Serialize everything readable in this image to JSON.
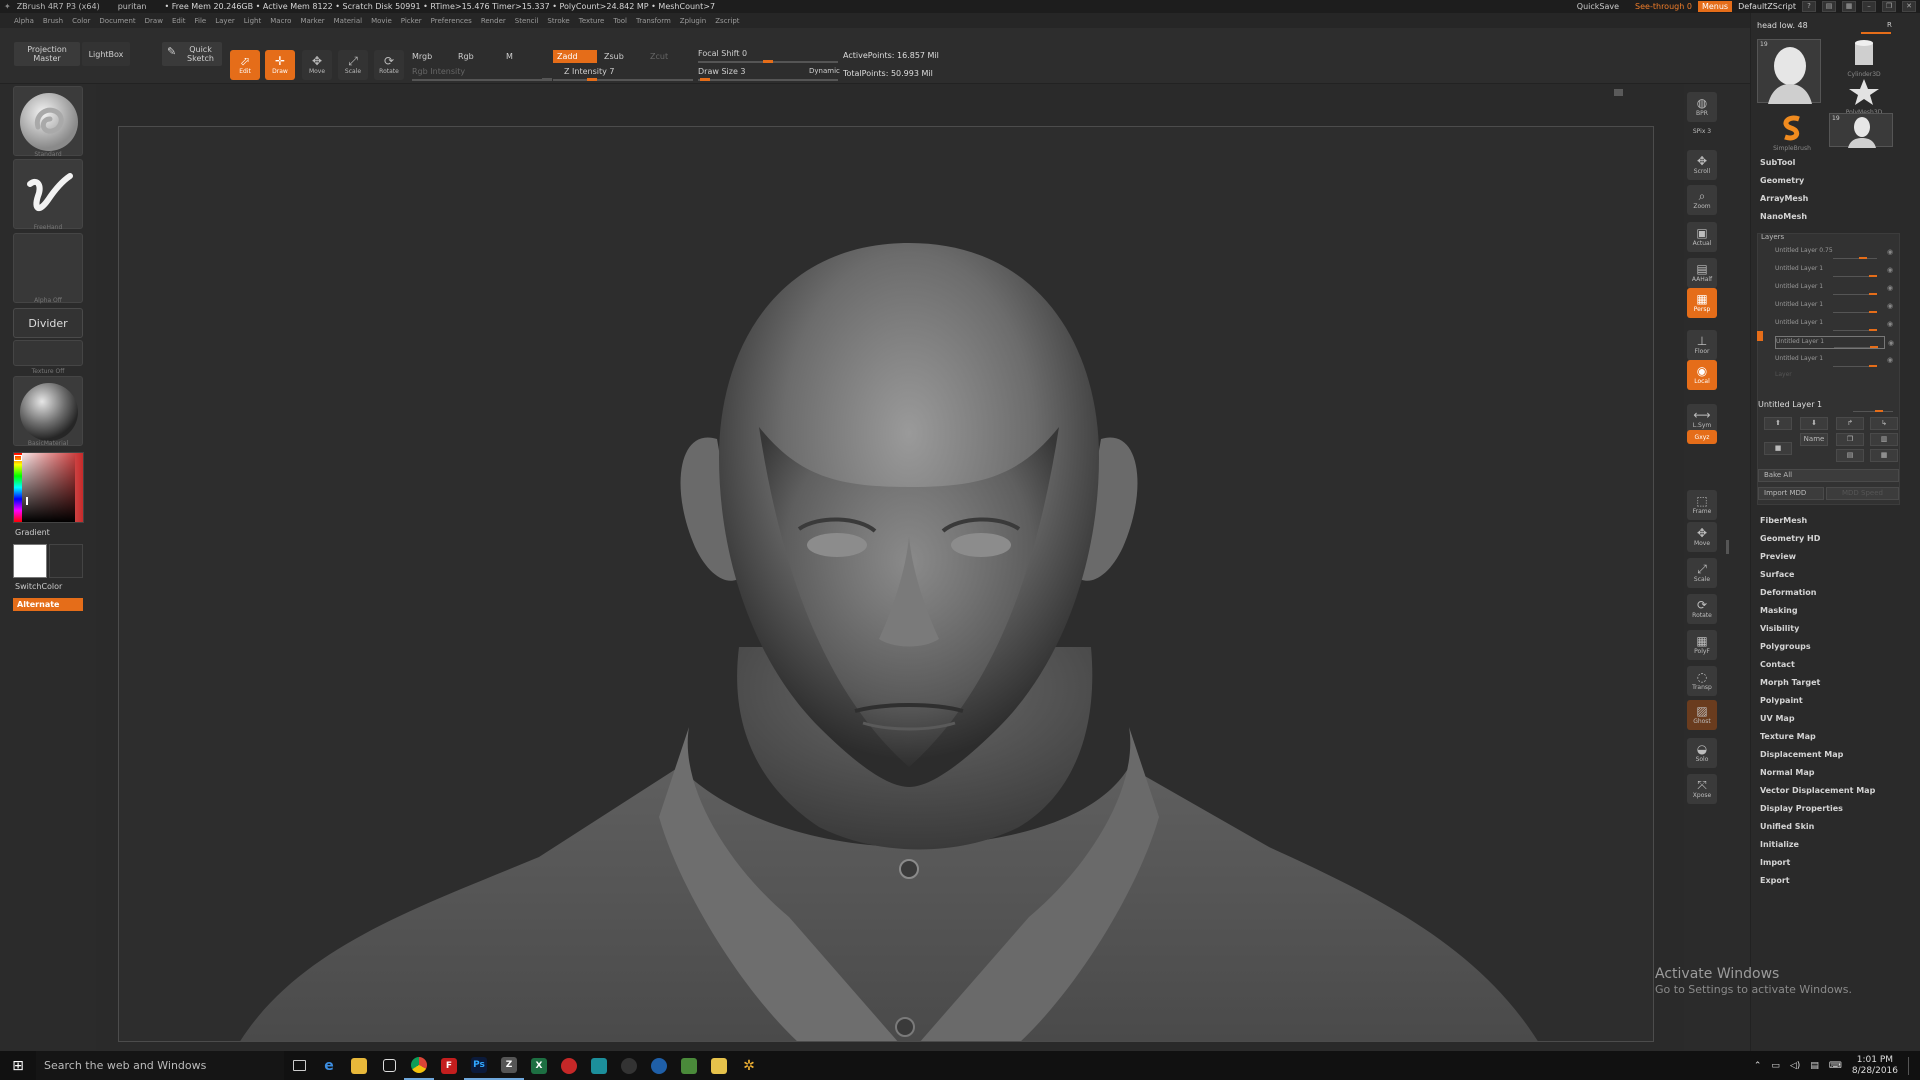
{
  "titlebar": {
    "app_title": "ZBrush 4R7 P3 (x64)",
    "project": "puritan",
    "stats": "• Free Mem 20.246GB • Active Mem 8122 • Scratch Disk 50991 • RTime>15.476 Timer>15.337 • PolyCount>24.842 MP • MeshCount>7",
    "quicksave": "QuickSave",
    "see_through": "See-through",
    "see_through_value": "0",
    "menus": "Menus",
    "script": "DefaultZScript"
  },
  "menubar": [
    "Alpha",
    "Brush",
    "Color",
    "Document",
    "Draw",
    "Edit",
    "File",
    "Layer",
    "Light",
    "Macro",
    "Marker",
    "Material",
    "Movie",
    "Picker",
    "Preferences",
    "Render",
    "Stencil",
    "Stroke",
    "Texture",
    "Tool",
    "Transform",
    "Zplugin",
    "Zscript"
  ],
  "toolbar": {
    "projection_master": "Projection\nMaster",
    "lightbox": "LightBox",
    "quick_sketch": "Quick\nSketch",
    "edit": "Edit",
    "draw": "Draw",
    "move": "Move",
    "scale": "Scale",
    "rotate": "Rotate",
    "mrgb": "Mrgb",
    "rgb": "Rgb",
    "m": "M",
    "rgb_intensity": "Rgb Intensity",
    "zadd": "Zadd",
    "zsub": "Zsub",
    "zcut": "Zcut",
    "z_intensity": "Z Intensity 7",
    "focal_shift": "Focal Shift 0",
    "draw_size": "Draw Size 3",
    "dynamic": "Dynamic",
    "active_points": "ActivePoints: 16.857 Mil",
    "total_points": "TotalPoints: 50.993 Mil"
  },
  "left_shelf": {
    "standard": "Standard",
    "freehand": "FreeHand",
    "alpha_off": "Alpha Off",
    "divider": "Divider",
    "texture_off": "Texture Off",
    "material": "BasicMaterial",
    "gradient": "Gradient",
    "switchcolor": "SwitchColor",
    "alternate": "Alternate"
  },
  "right_shelf": [
    {
      "name": "bpr",
      "label": "BPR"
    },
    {
      "name": "spix",
      "label": "SPix 3"
    },
    {
      "name": "scroll",
      "label": "Scroll"
    },
    {
      "name": "zoom",
      "label": "Zoom"
    },
    {
      "name": "actual",
      "label": "Actual"
    },
    {
      "name": "aahalf",
      "label": "AAHalf"
    },
    {
      "name": "persp",
      "label": "Persp"
    },
    {
      "name": "floor",
      "label": "Floor"
    },
    {
      "name": "local",
      "label": "Local"
    },
    {
      "name": "lsym",
      "label": "L.Sym"
    },
    {
      "name": "xyz",
      "label": "Gxyz"
    },
    {
      "name": "frame",
      "label": "Frame"
    },
    {
      "name": "move",
      "label": "Move"
    },
    {
      "name": "scale",
      "label": "Scale"
    },
    {
      "name": "rotate",
      "label": "Rotate"
    },
    {
      "name": "polyf",
      "label": "PolyF"
    },
    {
      "name": "transp",
      "label": "Transp"
    },
    {
      "name": "ghost",
      "label": "Ghost"
    },
    {
      "name": "solo",
      "label": "Solo"
    },
    {
      "name": "xpose",
      "label": "Xpose"
    }
  ],
  "tool_tray": {
    "title": "head low. 48",
    "r": "R",
    "thumbs": [
      "head low",
      "Cylinder3D",
      "PolyMesh3D",
      "SimpleBrush",
      "head low"
    ],
    "counts": [
      "19",
      "19"
    ],
    "menu_top": [
      "SubTool",
      "Geometry",
      "ArrayMesh",
      "NanoMesh"
    ],
    "layers_label": "Layers",
    "layers": [
      "Untitled Layer 0.75",
      "Untitled Layer 1",
      "Untitled Layer 1",
      "Untitled Layer 1",
      "Untitled Layer 1",
      "Untitled Layer 1",
      "Untitled Layer 1"
    ],
    "layer_empty": "Layer",
    "current_layer": "Untitled Layer 1",
    "name_btn": "Name",
    "bake_all": "Bake All",
    "import_mdd": "Import MDD",
    "mdd_speed": "MDD Speed",
    "menu_bottom": [
      "FiberMesh",
      "Geometry HD",
      "Preview",
      "Surface",
      "Deformation",
      "Masking",
      "Visibility",
      "Polygroups",
      "Contact",
      "Morph Target",
      "Polypaint",
      "UV Map",
      "Texture Map",
      "Displacement Map",
      "Normal Map",
      "Vector Displacement Map",
      "Display Properties",
      "Unified Skin",
      "Initialize",
      "Import",
      "Export"
    ]
  },
  "watermark": {
    "line1": "Activate Windows",
    "line2": "Go to Settings to activate Windows."
  },
  "taskbar": {
    "search": "Search the web and Windows",
    "time": "1:01 PM",
    "date": "8/28/2016"
  },
  "colors": {
    "accent": "#e56d19",
    "panel": "#2b2b2b",
    "taskbar": "#111111"
  }
}
